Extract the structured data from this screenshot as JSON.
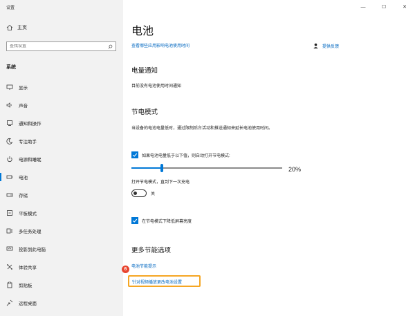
{
  "window": {
    "title": "设置",
    "controls": {
      "minimize": "—",
      "maximize": "☐",
      "close": "✕"
    }
  },
  "sidebar": {
    "home_label": "主页",
    "search_placeholder": "查找设置",
    "section_title": "系统",
    "items": [
      {
        "label": "显示",
        "icon": "display-icon"
      },
      {
        "label": "声音",
        "icon": "sound-icon"
      },
      {
        "label": "通知和操作",
        "icon": "notification-icon"
      },
      {
        "label": "专注助手",
        "icon": "focus-assist-icon"
      },
      {
        "label": "电源和睡眠",
        "icon": "power-icon"
      },
      {
        "label": "电池",
        "icon": "battery-icon",
        "active": true
      },
      {
        "label": "存储",
        "icon": "storage-icon"
      },
      {
        "label": "平板模式",
        "icon": "tablet-icon"
      },
      {
        "label": "多任务处理",
        "icon": "multitask-icon"
      },
      {
        "label": "投影到此电脑",
        "icon": "project-icon"
      },
      {
        "label": "体验共享",
        "icon": "shared-experience-icon"
      },
      {
        "label": "剪贴板",
        "icon": "clipboard-icon"
      },
      {
        "label": "远程桌面",
        "icon": "remote-desktop-icon"
      }
    ]
  },
  "main": {
    "title": "电池",
    "top_link": "查看哪些应用影响电池使用时间",
    "feedback": "提供反馈",
    "notification": {
      "heading": "电量通知",
      "text": "目前没有电池使用时间通知"
    },
    "saver": {
      "heading": "节电模式",
      "description": "当设备的电池电量低时，通过限制后台活动和推送通知来延长电池使用时间。",
      "auto_checkbox_label": "如果电池电量低于以下值，则自动打开节电模式:",
      "threshold_percent": 20,
      "threshold_label": "20%",
      "toggle_label": "打开节电模式，直到下一次充电",
      "toggle_state": "关",
      "brightness_checkbox_label": "在节电模式下降低屏幕亮度"
    },
    "more": {
      "heading": "更多节能选项",
      "tips_link": "电池节能提示",
      "video_link": "针对视频播放更改电池设置",
      "step_badge": "6"
    }
  },
  "colors": {
    "accent": "#0078d7",
    "link": "#0067c0",
    "highlight": "#f5a623",
    "badge": "#e8442e"
  }
}
